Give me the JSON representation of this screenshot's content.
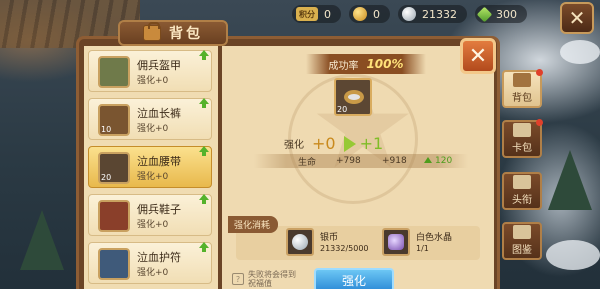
{
  "topbar": {
    "points_label": "积分",
    "points_value": "0",
    "gold_value": "0",
    "silver_value": "21332",
    "gem_value": "300"
  },
  "window": {
    "title": "背包"
  },
  "inventory": {
    "items": [
      {
        "name": "佣兵盔甲",
        "level": "强化+0",
        "badge": ""
      },
      {
        "name": "泣血长裤",
        "level": "强化+0",
        "badge": "10"
      },
      {
        "name": "泣血腰带",
        "level": "强化+0",
        "badge": "20"
      },
      {
        "name": "佣兵鞋子",
        "level": "强化+0",
        "badge": ""
      },
      {
        "name": "泣血护符",
        "level": "强化+0",
        "badge": ""
      }
    ]
  },
  "enhance": {
    "success_label": "成功率",
    "success_value": "100%",
    "equip_level": "20",
    "enhance_label": "强化",
    "current": "+0",
    "next": "+1",
    "stat_name": "生命",
    "stat_current": "+798",
    "stat_next": "+918",
    "stat_gain": "120",
    "cost_title": "强化消耗",
    "costs": [
      {
        "name": "银币",
        "amount": "21332/5000"
      },
      {
        "name": "白色水晶",
        "amount": "1/1"
      }
    ],
    "fail_note_1": "失败将会得到",
    "fail_note_2": "祝福值",
    "button_label": "强化"
  },
  "side_tabs": [
    {
      "label": "背包",
      "active": true
    },
    {
      "label": "卡包",
      "active": false
    },
    {
      "label": "头衔",
      "active": false
    },
    {
      "label": "图鉴",
      "active": false
    }
  ],
  "colors": {
    "accent_green": "#55b22b",
    "button_blue": "#2f8dd8",
    "gold_text": "#c98a1d"
  }
}
